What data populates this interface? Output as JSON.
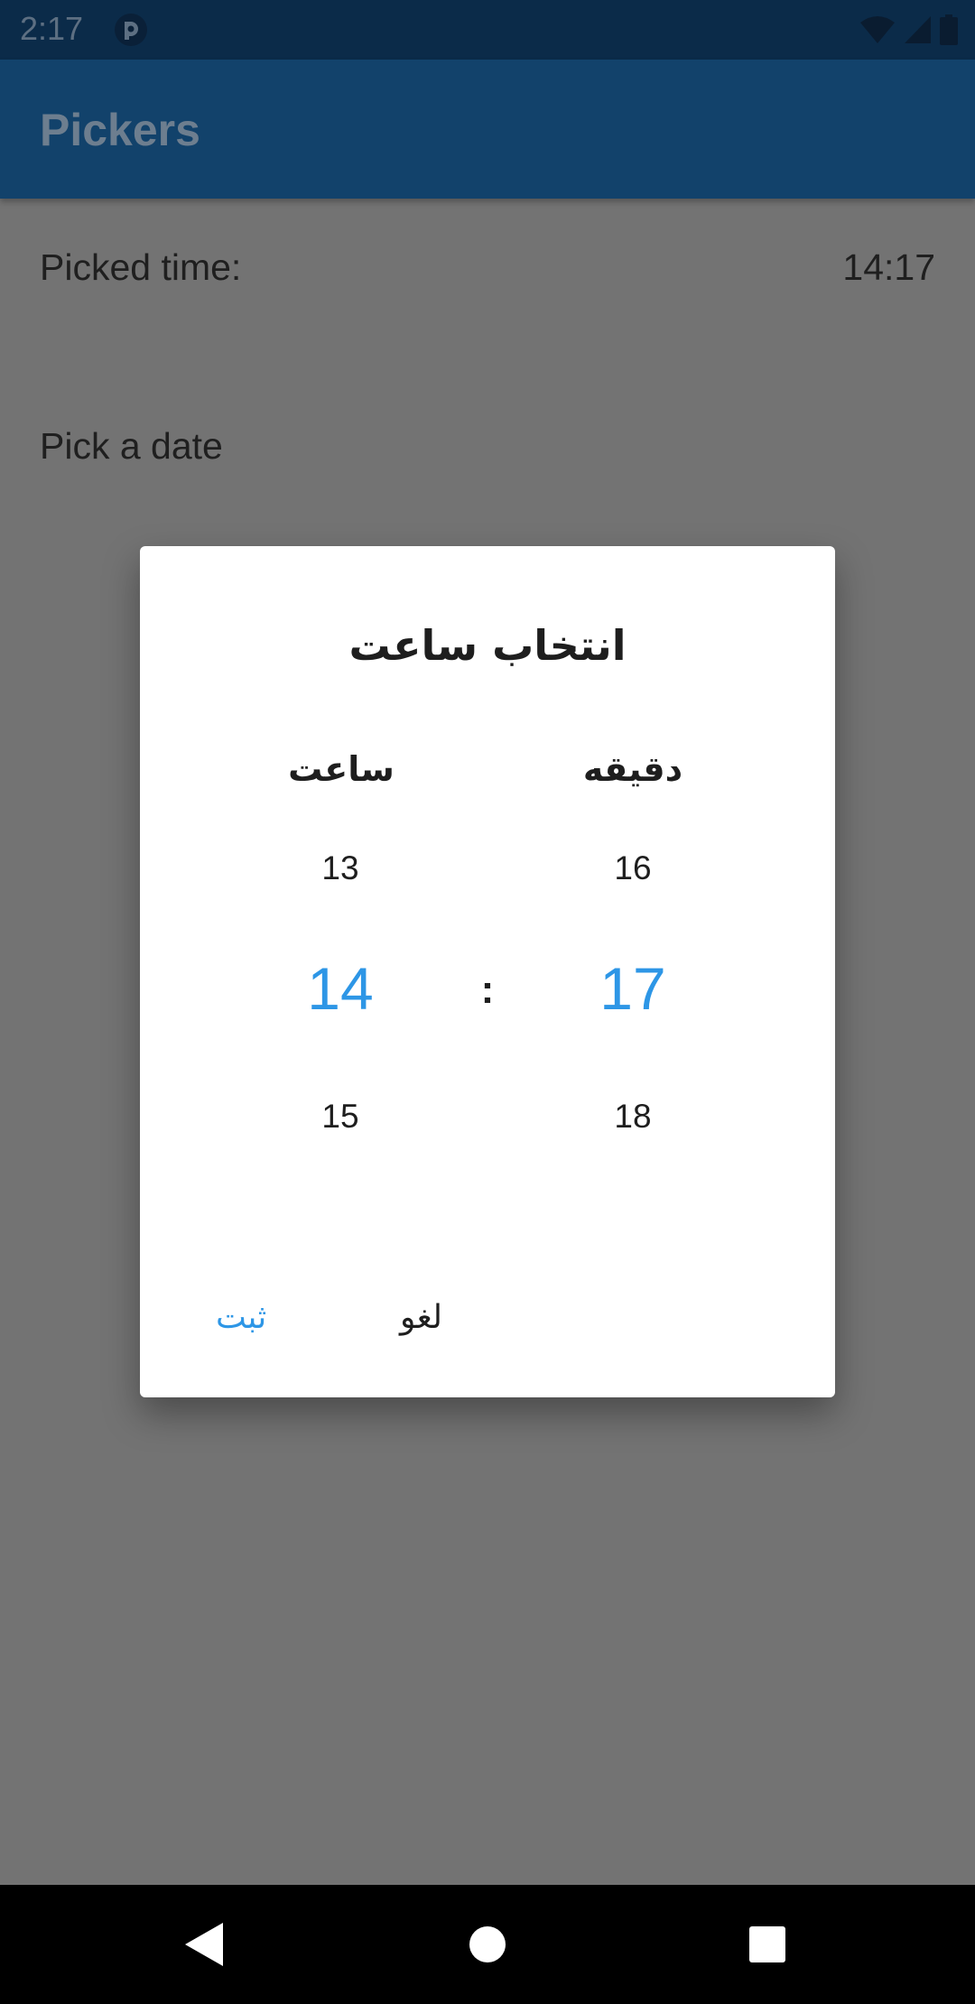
{
  "status_bar": {
    "time": "2:17",
    "icons": [
      "app-notification-icon",
      "wifi-icon",
      "cellular-signal-icon",
      "battery-icon"
    ]
  },
  "app_bar": {
    "title": "Pickers"
  },
  "content": {
    "picked_time_label": "Picked time:",
    "picked_time_value": "14:17",
    "pick_date_label": "Pick a date"
  },
  "dialog": {
    "title": "انتخاب ساعت",
    "hour_label": "ساعت",
    "minute_label": "دقیقه",
    "hour_wheel": {
      "previous": "13",
      "selected": "14",
      "next": "15"
    },
    "minute_wheel": {
      "previous": "16",
      "selected": "17",
      "next": "18"
    },
    "separator": ":",
    "ok_label": "ثبت",
    "cancel_label": "لغو"
  },
  "nav_bar": {
    "buttons": [
      "back-icon",
      "home-icon",
      "recents-icon"
    ]
  },
  "colors": {
    "accent": "#2d96e6",
    "app_bar": "#12426b",
    "status_bar": "#0b2b49",
    "scrim_background": "#737373",
    "dialog_background": "#ffffff"
  }
}
